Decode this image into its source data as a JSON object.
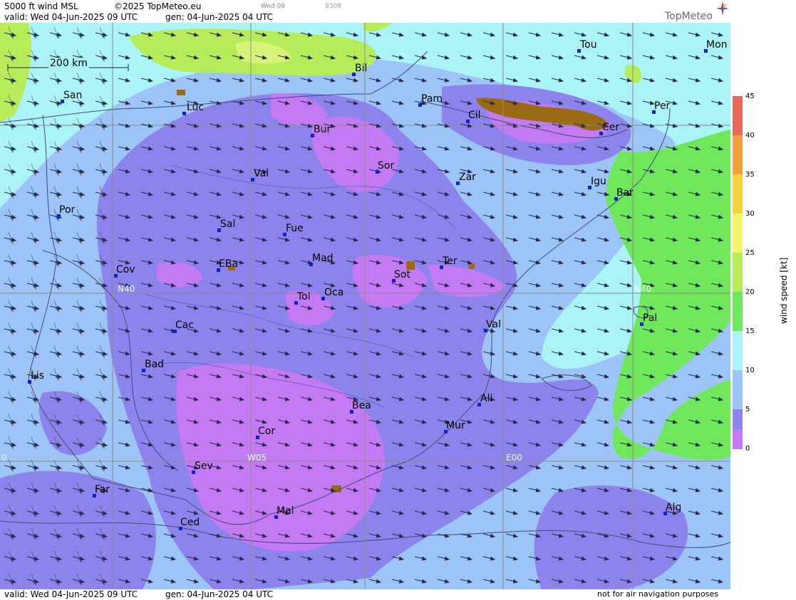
{
  "header": {
    "product": "5000 ft wind MSL",
    "copyright": "©2025 TopMeteo.eu",
    "day_code": "Wed 00",
    "run_code": "9308",
    "valid": "valid:  Wed  04-Jun-2025  09 UTC",
    "gen": "gen: 04-Jun-2025 04 UTC",
    "logo": "TopMeteo"
  },
  "footer": {
    "valid": "valid:  Wed  04-Jun-2025  09 UTC",
    "gen": "gen: 04-Jun-2025 04 UTC",
    "disclaimer": "not for air navigation purposes"
  },
  "scale_bar": "200 km",
  "grid_labels": {
    "n40_west": "N40",
    "n40_east": "N40",
    "w05": "W05",
    "e00": "E00",
    "w10": "0"
  },
  "legend": {
    "title": "wind speed [kt]",
    "ticks": [
      "45",
      "40",
      "35",
      "30",
      "25",
      "20",
      "15",
      "10",
      "5",
      "0"
    ],
    "colors": [
      "#e66a5a",
      "#f0a040",
      "#f4d23c",
      "#f4f46a",
      "#b6ec5a",
      "#6ee85a",
      "#aaf4f8",
      "#9cc4f6",
      "#8c84ec",
      "#c47af2"
    ]
  },
  "cities": [
    {
      "name": "San"
    },
    {
      "name": "Luc"
    },
    {
      "name": "Bil"
    },
    {
      "name": "Pam"
    },
    {
      "name": "Cil"
    },
    {
      "name": "Tou"
    },
    {
      "name": "Mon"
    },
    {
      "name": "Per"
    },
    {
      "name": "Cer"
    },
    {
      "name": "Bur"
    },
    {
      "name": "Sor"
    },
    {
      "name": "Zar"
    },
    {
      "name": "Igu"
    },
    {
      "name": "Bar"
    },
    {
      "name": "Val"
    },
    {
      "name": "Por"
    },
    {
      "name": "Sal"
    },
    {
      "name": "Fue"
    },
    {
      "name": "Mad"
    },
    {
      "name": "Cov"
    },
    {
      "name": "EBa"
    },
    {
      "name": "Sot"
    },
    {
      "name": "Ter"
    },
    {
      "name": "Tol"
    },
    {
      "name": "Oca"
    },
    {
      "name": "Pal"
    },
    {
      "name": "Cac"
    },
    {
      "name": "Val"
    },
    {
      "name": "Bad"
    },
    {
      "name": "Lis"
    },
    {
      "name": "Ali"
    },
    {
      "name": "Bea"
    },
    {
      "name": "Mur"
    },
    {
      "name": "Cor"
    },
    {
      "name": "Sev"
    },
    {
      "name": "Far"
    },
    {
      "name": "Mal"
    },
    {
      "name": "Alg"
    },
    {
      "name": "Ced"
    }
  ]
}
